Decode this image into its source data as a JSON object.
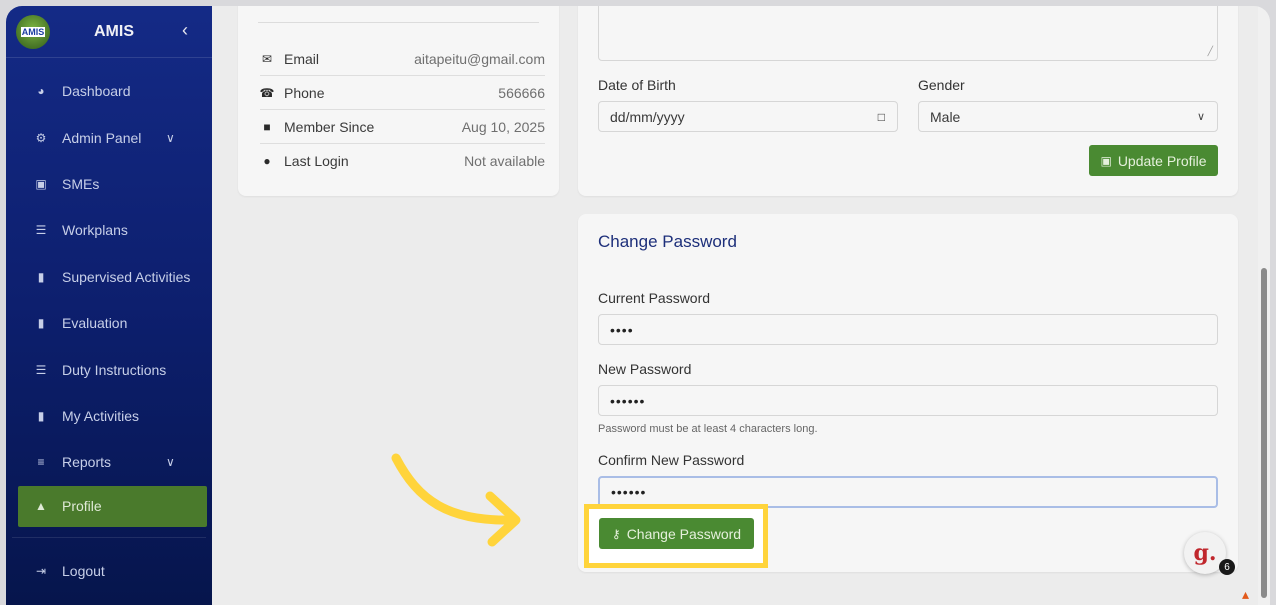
{
  "sidebar": {
    "brand": "AMIS",
    "logo_text": "AMIS",
    "items": [
      {
        "label": "Dashboard",
        "icon": "dashboard-icon"
      },
      {
        "label": "Admin Panel",
        "icon": "gear-icon"
      },
      {
        "label": "SMEs",
        "icon": "store-icon"
      },
      {
        "label": "Workplans",
        "icon": "list-icon"
      },
      {
        "label": "Supervised Activities",
        "icon": "clipboard-icon"
      },
      {
        "label": "Evaluation",
        "icon": "clipboard-check-icon"
      },
      {
        "label": "Duty Instructions",
        "icon": "list-icon"
      },
      {
        "label": "My Activities",
        "icon": "clipboard-icon"
      },
      {
        "label": "Reports",
        "icon": "chart-icon"
      },
      {
        "label": "Profile",
        "icon": "user-icon"
      }
    ],
    "logout": "Logout"
  },
  "info": {
    "rows": [
      {
        "label": "Email",
        "value": "aitapeitu@gmail.com"
      },
      {
        "label": "Phone",
        "value": "566666"
      },
      {
        "label": "Member Since",
        "value": "Aug 10, 2025"
      },
      {
        "label": "Last Login",
        "value": "Not available"
      }
    ]
  },
  "profile_form": {
    "dob_label": "Date of Birth",
    "dob_placeholder": "dd/mm/yyyy",
    "gender_label": "Gender",
    "gender_value": "Male",
    "update_button": "Update Profile"
  },
  "password_form": {
    "title": "Change Password",
    "current_label": "Current Password",
    "current_value": "••••",
    "new_label": "New Password",
    "new_value": "••••••",
    "hint": "Password must be at least 4 characters long.",
    "confirm_label": "Confirm New Password",
    "confirm_value": "••••••",
    "submit_button": "Change Password"
  },
  "widget": {
    "letter": "g.",
    "count": "6"
  },
  "colors": {
    "sidebar": "#0d1f6e",
    "active": "#4a7a2c",
    "button": "#4a8a32",
    "highlight": "#ffd43b",
    "title": "#1d2f7a"
  }
}
